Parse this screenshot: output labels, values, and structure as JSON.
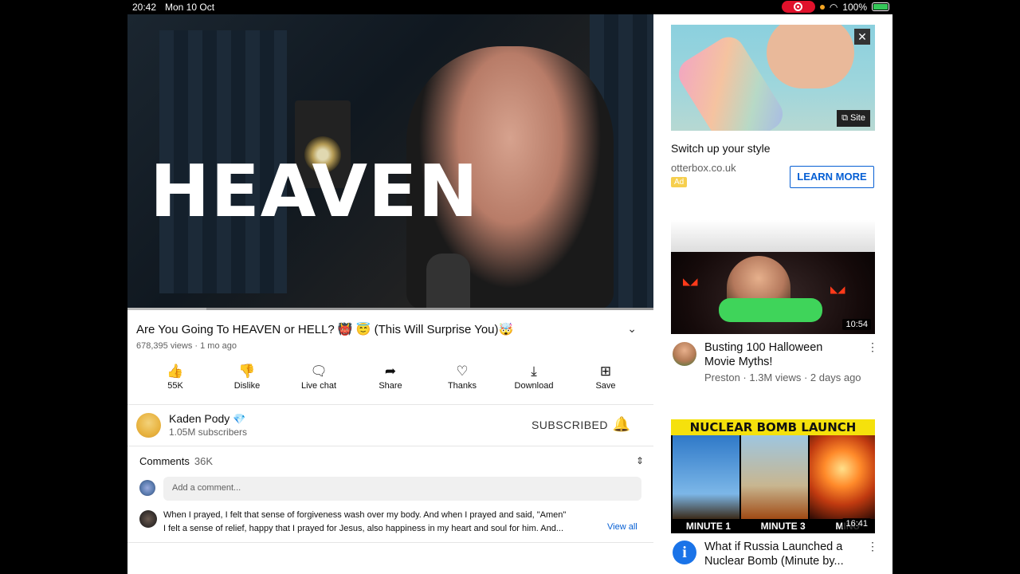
{
  "status_bar": {
    "time": "20:42",
    "date": "Mon 10 Oct",
    "battery": "100%"
  },
  "video": {
    "overlay_text": "HEAVEN",
    "progress": 0.15,
    "title": "Are You Going To HEAVEN or HELL? 👹 😇 (This Will Surprise You)🤯",
    "views": "678,395 views",
    "age": "1 mo ago",
    "meta_sep": "·"
  },
  "actions": [
    {
      "label": "55K",
      "icon": "thumbs-up-icon",
      "glyph": "👍"
    },
    {
      "label": "Dislike",
      "icon": "thumbs-down-icon",
      "glyph": "👎"
    },
    {
      "label": "Live chat",
      "icon": "chat-icon",
      "glyph": "🗨"
    },
    {
      "label": "Share",
      "icon": "share-icon",
      "glyph": "➦"
    },
    {
      "label": "Thanks",
      "icon": "thanks-icon",
      "glyph": "♡"
    },
    {
      "label": "Download",
      "icon": "download-icon",
      "glyph": "⤓"
    },
    {
      "label": "Save",
      "icon": "save-icon",
      "glyph": "⊞"
    }
  ],
  "channel": {
    "name": "Kaden Pody",
    "badge": "💎",
    "subscribers": "1.05M subscribers",
    "subscribe_label": "SUBSCRIBED",
    "bell": "🔔"
  },
  "comments": {
    "header": "Comments",
    "count": "36K",
    "placeholder": "Add a comment...",
    "top_line1": "When I prayed, I felt that sense of forgiveness wash over my body. And when I prayed and said, \"Amen\"",
    "top_line2": "I felt a sense of relief, happy that I prayed for Jesus, also happiness in my heart and soul for him. And...",
    "view_all": "View all"
  },
  "ad": {
    "close": "✕",
    "site": "Site",
    "title": "Switch up your style",
    "domain": "otterbox.co.uk",
    "badge": "Ad",
    "cta": "LEARN MORE"
  },
  "related": [
    {
      "title": "Busting 100 Halloween Movie Myths!",
      "meta": "Preston · 1.3M views · 2 days ago",
      "duration": "10:54"
    },
    {
      "title": "What if Russia Launched a Nuclear Bomb (Minute by...",
      "meta": "",
      "duration": "16:41",
      "banner": "NUCLEAR BOMB LAUNCH",
      "labels": [
        "MINUTE 1",
        "MINUTE 3",
        "MINU"
      ]
    }
  ]
}
